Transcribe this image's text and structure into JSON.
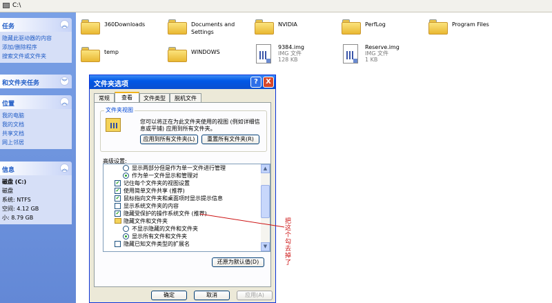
{
  "address": {
    "path": "C:\\"
  },
  "sidebar": {
    "tasks": {
      "title": "任务",
      "items": [
        "隐藏此驱动器的内容",
        "添加/删除程序",
        "搜索文件或文件夹"
      ]
    },
    "file_tasks": {
      "title": "和文件夹任务"
    },
    "places": {
      "title": "位置",
      "items": [
        "我的电脑",
        "我的文档",
        "共享文档",
        "网上邻居"
      ]
    },
    "details": {
      "title": "信息",
      "name": "磁盘 (C:)",
      "type": "磁盘",
      "fs": "系统: NTFS",
      "free": "空间: 4.12 GB",
      "size": "小: 8.79 GB"
    }
  },
  "files": [
    {
      "name": "360Downloads",
      "kind": "folder"
    },
    {
      "name": "Documents and Settings",
      "kind": "folder"
    },
    {
      "name": "NVIDIA",
      "kind": "folder"
    },
    {
      "name": "PerfLog",
      "kind": "folder"
    },
    {
      "name": "Program Files",
      "kind": "folder"
    },
    {
      "name": "temp",
      "kind": "folder"
    },
    {
      "name": "WINDOWS",
      "kind": "folder"
    },
    {
      "name": "9384.img",
      "type": "IMG 文件",
      "size": "128 KB",
      "kind": "file"
    },
    {
      "name": "Reserve.img",
      "type": "IMG 文件",
      "size": "1 KB",
      "kind": "file"
    }
  ],
  "dialog": {
    "title": "文件夹选项",
    "help": "?",
    "close": "X",
    "tabs": [
      "常规",
      "查看",
      "文件类型",
      "脱机文件"
    ],
    "group_label": "文件夹视图",
    "group_text": "您可以将正在为此文件夹使用的视图 (例如详细信息或平铺) 应用到所有文件夹。",
    "apply_all": "应用到所有文件夹(L)",
    "reset_all": "重置所有文件夹(R)",
    "advanced_label": "高级设置:",
    "advanced": [
      {
        "type": "radio",
        "checked": false,
        "text": "显示两部分但是作为单一文件进行管理"
      },
      {
        "type": "radio",
        "checked": true,
        "text": "作为单一文件显示和管理对"
      },
      {
        "type": "check",
        "checked": true,
        "text": "记住每个文件夹的视图设置"
      },
      {
        "type": "check",
        "checked": true,
        "text": "使用简单文件共享 (推荐)"
      },
      {
        "type": "check",
        "checked": true,
        "text": "鼠标指向文件夹和桌面项时显示提示信息"
      },
      {
        "type": "check",
        "checked": false,
        "text": "显示系统文件夹的内容"
      },
      {
        "type": "check",
        "checked": true,
        "text": "隐藏受保护的操作系统文件 (推荐)"
      },
      {
        "type": "folder",
        "checked": false,
        "text": "隐藏文件和文件夹"
      },
      {
        "type": "radio",
        "checked": false,
        "text": "不显示隐藏的文件和文件夹"
      },
      {
        "type": "radio",
        "checked": true,
        "text": "显示所有文件和文件夹"
      },
      {
        "type": "check",
        "checked": false,
        "text": "隐藏已知文件类型的扩展名"
      }
    ],
    "restore": "还原为默认值(D)",
    "ok": "确定",
    "cancel": "取消",
    "apply": "应用(A)"
  },
  "annotation": {
    "text": "把这个勾去掉了",
    "color": "#cc1111"
  }
}
